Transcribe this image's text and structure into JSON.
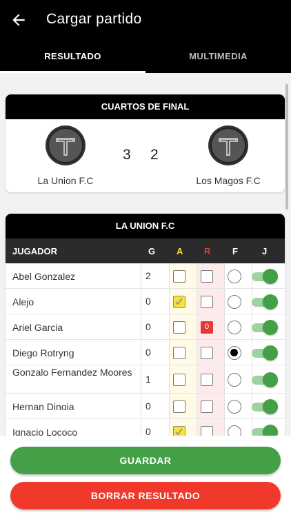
{
  "header": {
    "title": "Cargar partido",
    "back_icon": "arrow-left-icon"
  },
  "tabs": [
    {
      "label": "RESULTADO",
      "active": true
    },
    {
      "label": "MULTIMEDIA",
      "active": false
    }
  ],
  "match": {
    "stage": "CUARTOS DE FINAL",
    "home": {
      "name": "La Union F.C",
      "score": "3"
    },
    "away": {
      "name": "Los Magos F.C",
      "score": "2"
    }
  },
  "roster": {
    "team": "LA UNION F.C",
    "columns": {
      "player": "JUGADOR",
      "goals": "G",
      "yellow": "A",
      "red": "R",
      "featured": "F",
      "played": "J"
    },
    "players": [
      {
        "name": "Abel Gonzalez",
        "goals": "2",
        "yellow": false,
        "red": null,
        "featured": false,
        "played": true
      },
      {
        "name": "Alejo",
        "goals": "0",
        "yellow": true,
        "red": null,
        "featured": false,
        "played": true
      },
      {
        "name": "Ariel Garcia",
        "goals": "0",
        "yellow": false,
        "red": "0",
        "featured": false,
        "played": true
      },
      {
        "name": "Diego Rotryng",
        "goals": "0",
        "yellow": false,
        "red": null,
        "featured": true,
        "played": true
      },
      {
        "name": "Gonzalo Fernandez Moores",
        "goals": "1",
        "yellow": false,
        "red": null,
        "featured": false,
        "played": true
      },
      {
        "name": "Hernan Dinoia",
        "goals": "0",
        "yellow": false,
        "red": null,
        "featured": false,
        "played": true
      },
      {
        "name": "Ignacio Lococo",
        "goals": "0",
        "yellow": true,
        "red": null,
        "featured": false,
        "played": true
      }
    ]
  },
  "actions": {
    "save": "GUARDAR",
    "clear": "BORRAR RESULTADO"
  },
  "colors": {
    "appbar": "#000000",
    "save": "#43a047",
    "clear": "#f0392b",
    "toggle_on": "#43a047"
  }
}
